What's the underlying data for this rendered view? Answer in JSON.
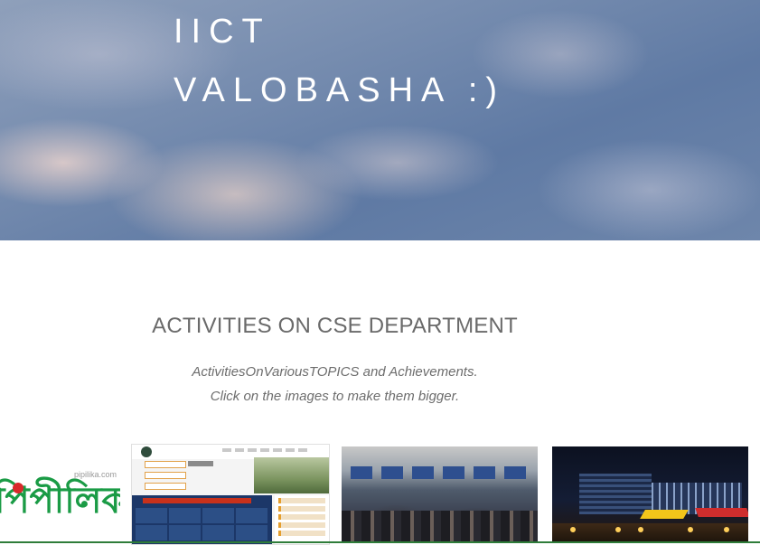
{
  "site": {
    "title_line1": "IICT",
    "title_line2": "VALOBASHA :)"
  },
  "section": {
    "heading": "ACTIVITIES ON CSE DEPARTMENT",
    "subtitle_line1": "ActivitiesOnVariousTOPICS and Achievements.",
    "subtitle_line2": "Click on the images to make them bigger."
  },
  "gallery": {
    "logo_text": "পিপীলিকা",
    "logo_domain": "pipilika.com"
  },
  "colors": {
    "hero_sky": "#6f87ad",
    "title_text": "#ffffff",
    "heading_text": "#6a6a6a",
    "logo_green": "#1a9b45",
    "logo_red": "#d8282b"
  }
}
